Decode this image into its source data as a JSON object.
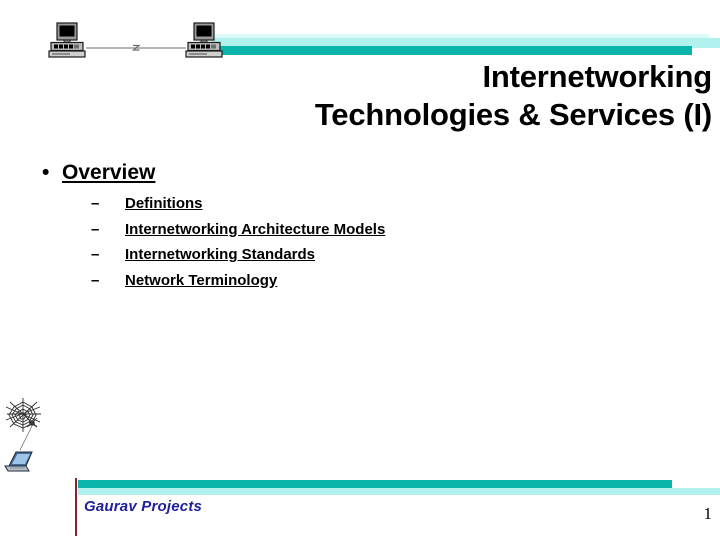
{
  "slide": {
    "title_lines": [
      "Internetworking",
      "Technologies & Services (I)"
    ],
    "title_full": "Internetworking Technologies & Services (I)"
  },
  "header_graphic": {
    "left_computer_icon": "desktop-computer-icon",
    "right_computer_icon": "desktop-computer-icon",
    "link_icon": "network-link-icon",
    "bar_light_color": "#b2f2ee",
    "bar_teal_color": "#0bb5ab",
    "bar_pale_color": "#ddfaf8"
  },
  "outline": {
    "level1": {
      "bullet_glyph": "•",
      "label": "Overview"
    },
    "level2_dash_glyph": "–",
    "items": [
      {
        "label": "Definitions"
      },
      {
        "label": "Internetworking Architecture Models"
      },
      {
        "label": "Internetworking Standards"
      },
      {
        "label": "Network Terminology"
      }
    ]
  },
  "footer": {
    "logo_icon": "spider-web-laptop-icon",
    "label": "Gaurav Projects",
    "label_color": "#21209c",
    "rule_color": "#8b2232",
    "bar_teal_color": "#0bb5ab",
    "bar_light_color": "#b2f2ee",
    "page_number": "1"
  }
}
